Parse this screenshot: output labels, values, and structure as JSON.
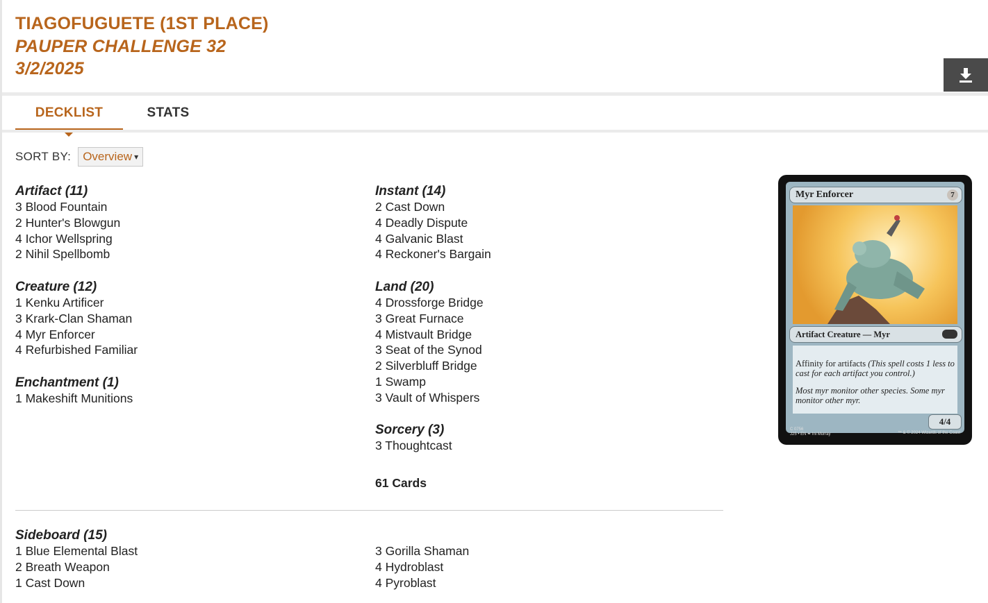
{
  "header": {
    "player": "TIAGOFUGUETE (1ST PLACE)",
    "event": "PAUPER CHALLENGE 32",
    "date": "3/2/2025"
  },
  "download_icon": "download-icon",
  "tabs": [
    {
      "label": "DECKLIST",
      "active": true
    },
    {
      "label": "STATS",
      "active": false
    }
  ],
  "sort": {
    "label": "SORT BY:",
    "selected": "Overview"
  },
  "deck": {
    "artifact": {
      "title": "Artifact (11)",
      "cards": [
        "3 Blood Fountain",
        "2 Hunter's Blowgun",
        "4 Ichor Wellspring",
        "2 Nihil Spellbomb"
      ]
    },
    "creature": {
      "title": "Creature (12)",
      "cards": [
        "1 Kenku Artificer",
        "3 Krark-Clan Shaman",
        "4 Myr Enforcer",
        "4 Refurbished Familiar"
      ]
    },
    "enchantment": {
      "title": "Enchantment (1)",
      "cards": [
        "1 Makeshift Munitions"
      ]
    },
    "instant": {
      "title": "Instant (14)",
      "cards": [
        "2 Cast Down",
        "4 Deadly Dispute",
        "4 Galvanic Blast",
        "4 Reckoner's Bargain"
      ]
    },
    "land": {
      "title": "Land (20)",
      "cards": [
        "4 Drossforge Bridge",
        "3 Great Furnace",
        "4 Mistvault Bridge",
        "3 Seat of the Synod",
        "2 Silverbluff Bridge",
        "1 Swamp",
        "3 Vault of Whispers"
      ]
    },
    "sorcery": {
      "title": "Sorcery (3)",
      "cards": [
        "3 Thoughtcast"
      ]
    },
    "total": "61 Cards"
  },
  "sideboard": {
    "title": "Sideboard (15)",
    "col1": [
      "1 Blue Elemental Blast",
      "2 Breath Weapon",
      "1 Cast Down"
    ],
    "col2": [
      "3 Gorilla Shaman",
      "4 Hydroblast",
      "4 Pyroblast"
    ]
  },
  "card_preview": {
    "name": "Myr Enforcer",
    "cost": "7",
    "type": "Artifact Creature — Myr",
    "rules_a": "Affinity for artifacts ",
    "rules_b": "(This spell costs 1 less to cast for each artifact you control.)",
    "flavor": "Most myr monitor other species. Some myr monitor other myr.",
    "pt": "4/4",
    "collector": "C 0756",
    "set_line": "J25 • EN ✒ Ini Murray",
    "copyright": "™ & © 2024 Wizards of the Coast"
  }
}
